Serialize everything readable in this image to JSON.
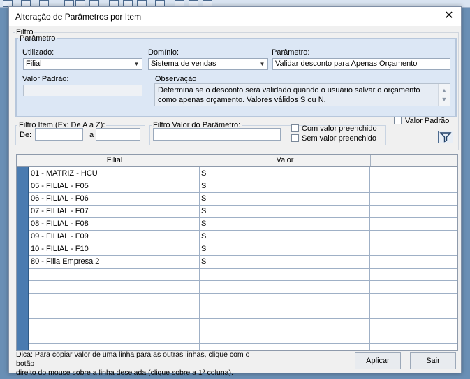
{
  "window": {
    "title": "Alteração de Parâmetros por Item",
    "close_glyph": "✕"
  },
  "filtro": {
    "legend": "Filtro",
    "parametro": {
      "legend": "Parâmetro",
      "utilizado_label": "Utilizado:",
      "utilizado_value": "Filial",
      "dominio_label": "Domínio:",
      "dominio_value": "Sistema de vendas",
      "parametro_label": "Parâmetro:",
      "parametro_value": "Validar desconto para Apenas Orçamento",
      "valor_padrao_label": "Valor Padrão:",
      "valor_padrao_value": "",
      "observacao_label": "Observação",
      "observacao_text": "Determina se o desconto será validado quando o usuário salvar o orçamento como apenas orçamento. Valores válidos S ou N."
    },
    "filtro_item": {
      "legend": "Filtro Item (Ex: De A a Z):",
      "de_label": "De:",
      "de_value": "",
      "a_label": "a",
      "a_value": ""
    },
    "filtro_valor": {
      "legend": "Filtro Valor do Parâmetro:",
      "value": "",
      "com_valor_label": "Com valor preenchido",
      "sem_valor_label": "Sem valor preenchido"
    },
    "valor_padrao_checkbox_label": "Valor Padrão",
    "filter_icon": "funnel-icon"
  },
  "grid": {
    "columns": [
      "Filial",
      "Valor"
    ],
    "rows": [
      {
        "filial": "01 - MATRIZ - HCU",
        "valor": "S"
      },
      {
        "filial": "05 - FILIAL - F05",
        "valor": "S"
      },
      {
        "filial": "06 - FILIAL - F06",
        "valor": "S"
      },
      {
        "filial": "07 - FILIAL - F07",
        "valor": "S"
      },
      {
        "filial": "08 - FILIAL - F08",
        "valor": "S"
      },
      {
        "filial": "09 - FILIAL - F09",
        "valor": "S"
      },
      {
        "filial": "10 - FILIAL - F10",
        "valor": "S"
      },
      {
        "filial": "80 - Filia Empresa 2",
        "valor": "S"
      }
    ],
    "empty_rows": 7
  },
  "footer": {
    "hint_line1": "Dica: Para copiar valor de uma linha para as outras linhas, clique com o botão",
    "hint_line2": "direito do mouse sobre a linha desejada (clique sobre a 1ª coluna).",
    "aplicar_label": "Aplicar",
    "sair_label": "Sair"
  },
  "colors": {
    "panel_bg": "#dce7f5",
    "row_indicator": "#4a7bb0"
  }
}
